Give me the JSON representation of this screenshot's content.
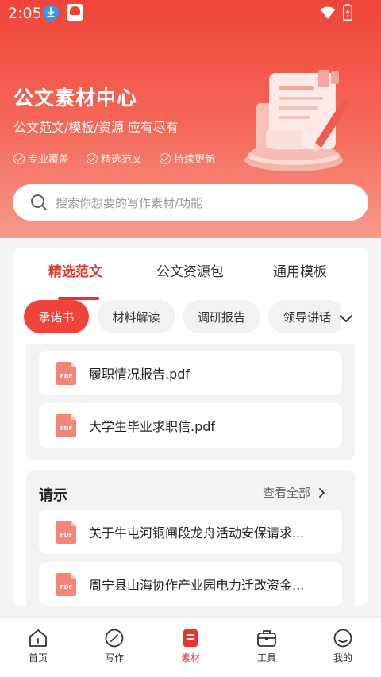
{
  "status_bar": {
    "time": "2:05"
  },
  "hero": {
    "title": "公文素材中心",
    "subtitle": "公文范文/模板/资源 应有尽有",
    "features": [
      "专业覆盖",
      "精选范文",
      "持续更新"
    ]
  },
  "search": {
    "placeholder": "搜索你想要的写作素材/功能"
  },
  "tabs": [
    {
      "label": "精选范文",
      "active": true
    },
    {
      "label": "公文资源包",
      "active": false
    },
    {
      "label": "通用模板",
      "active": false
    }
  ],
  "chips": [
    {
      "label": "承诺书",
      "active": true
    },
    {
      "label": "材料解读",
      "active": false
    },
    {
      "label": "调研报告",
      "active": false
    },
    {
      "label": "领导讲话",
      "active": false
    }
  ],
  "featured_files": [
    {
      "name": "履职情况报告.pdf",
      "icon": "pdf-icon"
    },
    {
      "name": "大学生毕业求职信.pdf",
      "icon": "pdf-icon"
    }
  ],
  "section": {
    "title": "请示",
    "see_all": "查看全部",
    "files": [
      {
        "name": "关于牛屯河铜闸段龙舟活动安保请求...",
        "icon": "pdf-icon"
      },
      {
        "name": "周宁县山海协作产业园电力迁改资金...",
        "icon": "pdf-icon"
      }
    ]
  },
  "bottom_nav": [
    {
      "label": "首页",
      "icon": "home-icon",
      "active": false
    },
    {
      "label": "写作",
      "icon": "pen-circle-icon",
      "active": false
    },
    {
      "label": "素材",
      "icon": "document-icon",
      "active": true
    },
    {
      "label": "工具",
      "icon": "toolbox-icon",
      "active": false
    },
    {
      "label": "我的",
      "icon": "user-icon",
      "active": false
    }
  ],
  "colors": {
    "accent": "#e8342c",
    "hero_top": "#f0443a",
    "hero_bottom": "#f79a8b"
  }
}
